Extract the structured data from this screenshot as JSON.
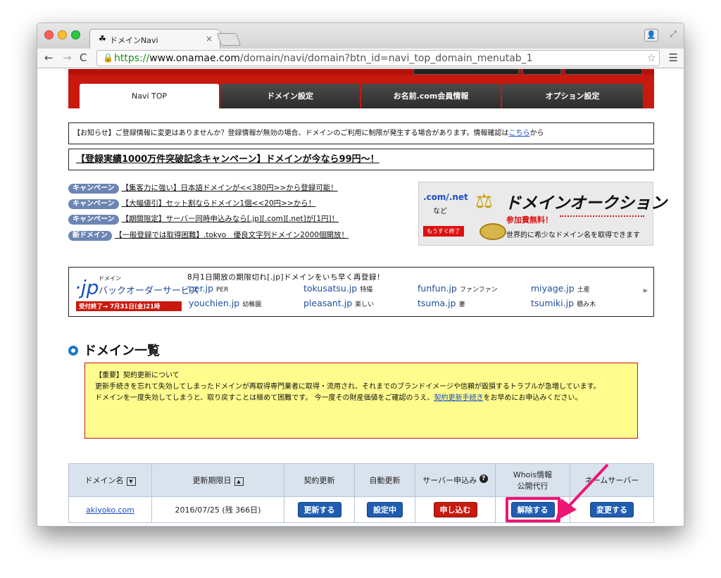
{
  "browser": {
    "tab_title": "ドメインNavi",
    "tab_close": "×",
    "url_scheme": "https://",
    "url_domain": "www.onamae.com",
    "url_path": "/domain/navi/domain?btn_id=navi_top_domain_menutab_1"
  },
  "nav_tabs": [
    "Navi TOP",
    "ドメイン設定",
    "お名前.com会員情報",
    "オプション設定"
  ],
  "notice": {
    "prefix": "【お知らせ】ご登録情報に変更はありませんか？登録情報が無効の場合、ドメインのご利用に制限が発生する場合があります。情報確認は",
    "link": "こちら",
    "suffix": "から"
  },
  "campaign_banner": "【登録実績1000万件突破記念キャンペーン】ドメインが今なら99円〜！",
  "news": [
    {
      "badge": "キャンペーン",
      "text": "【集客力に強い】日本語ドメインが<<380円>>から登録可能！"
    },
    {
      "badge": "キャンペーン",
      "text": "【大幅値引】セット割ならドメイン1個<<20円>>から！"
    },
    {
      "badge": "キャンペーン",
      "text": "【期間限定】サーバー同時申込みなら[.jp][.com][.net]が[1円]！"
    },
    {
      "badge": "新ドメイン",
      "text": "【一般登録では取得困難】.tokyo　優良文字列ドメイン2000個開放！"
    }
  ],
  "auction": {
    "tld": ".com/.net",
    "nado": "など",
    "title": "ドメインオークション",
    "free": "参加費無料！",
    "soon": "もうすぐ終了",
    "desc": "世界的に希少なドメイン名を取得できます"
  },
  "jp_backorder": {
    "logo_small": "ドメイン",
    "logo_title": "バックオーダーサービス",
    "deadline": "受付終了→ 7月31日(金)21時",
    "heading": "8月1日開放の期限切れ[.jp]ドメインをいち早く再登録！",
    "row1": [
      {
        "name": "per.jp",
        "note": "PER"
      },
      {
        "name": "tokusatsu.jp",
        "note": "特撮"
      },
      {
        "name": "funfun.jp",
        "note": "ファンファン"
      },
      {
        "name": "miyage.jp",
        "note": "土産"
      }
    ],
    "row2": [
      {
        "name": "youchien.jp",
        "note": "幼稚園"
      },
      {
        "name": "pleasant.jp",
        "note": "楽しい"
      },
      {
        "name": "tsuma.jp",
        "note": "妻"
      },
      {
        "name": "tsumiki.jp",
        "note": "積み木"
      }
    ]
  },
  "section_title": "ドメイン一覧",
  "warning": {
    "title": "【重要】契約更新について",
    "line1": "更新手続きを忘れて失効してしまったドメインが再取得専門業者に取得・流用され、それまでのブランドイメージや信頼が毀損するトラブルが急増しています。",
    "line2_prefix": "ドメインを一度失効してしまうと、取り戻すことは極めて困難です。 今一度その財産価値をご確認のうえ、",
    "link": "契約更新手続き",
    "line2_suffix": "をお早めにお申込みください。"
  },
  "table": {
    "headers": {
      "domain": "ドメイン名",
      "expiry": "更新期限日",
      "renew": "契約更新",
      "auto": "自動更新",
      "server": "サーバー申込み",
      "whois_1": "Whois情報",
      "whois_2": "公開代行",
      "ns": "ネームサーバー"
    },
    "row": {
      "domain": "akiyoko.com",
      "expiry": "2016/07/25 (残 366日)",
      "renew_btn": "更新する",
      "auto_btn": "設定中",
      "server_btn": "申し込む",
      "whois_btn": "解除する",
      "ns_btn": "変更する"
    }
  },
  "colors": {
    "brand_red": "#c8190f",
    "button_blue": "#1f5db0",
    "highlight_pink": "#ee1576"
  }
}
